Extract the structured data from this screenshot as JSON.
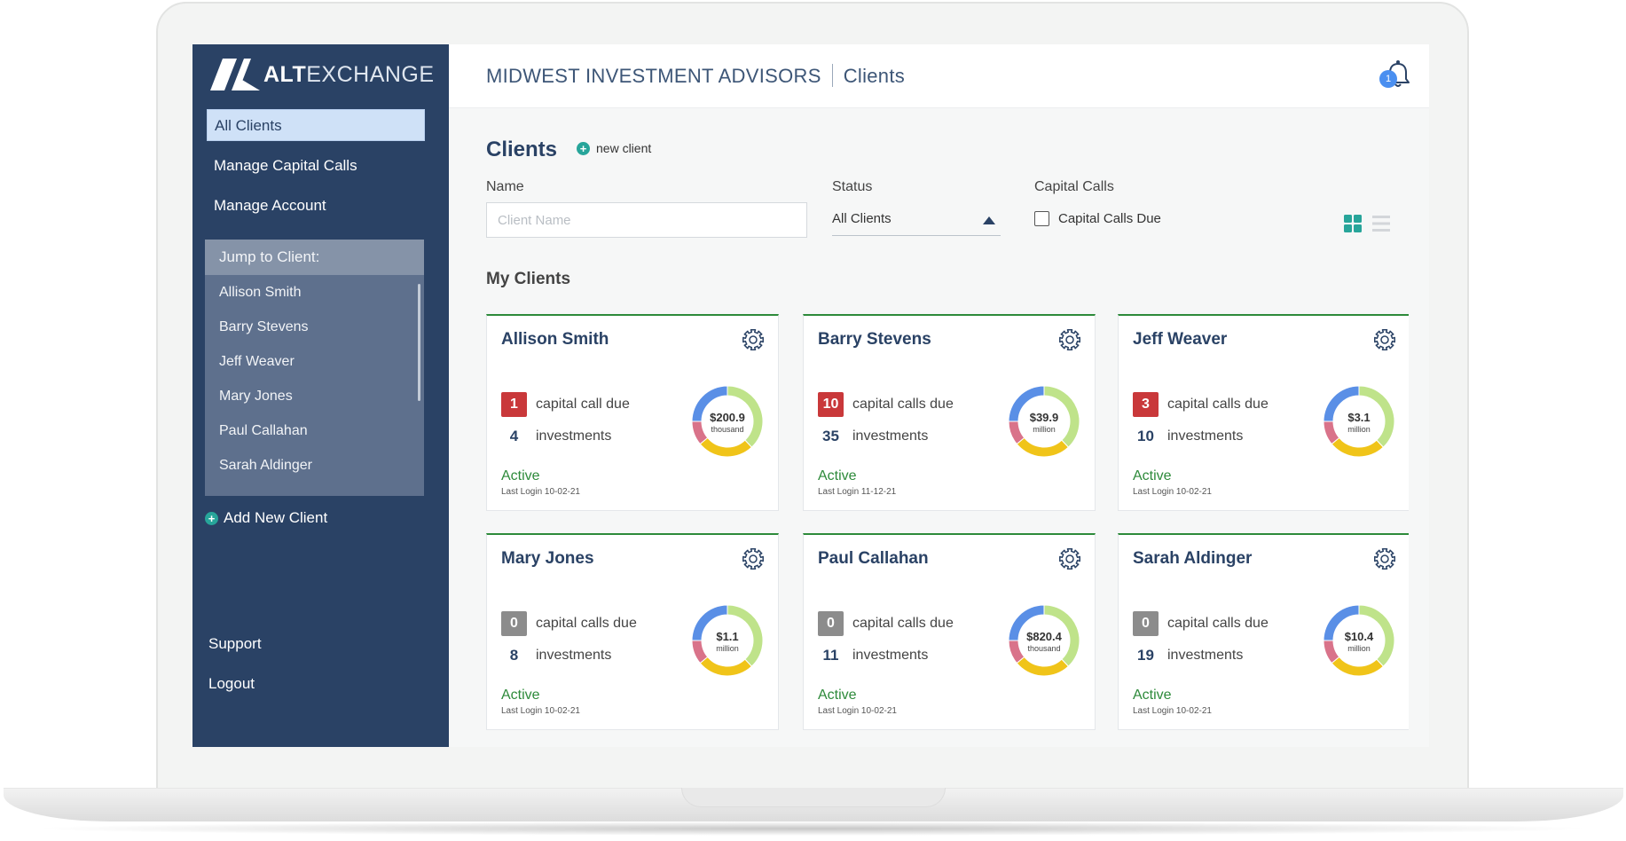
{
  "app": {
    "logo_bold": "ALT",
    "logo_light": "EXCHANGE"
  },
  "header": {
    "org_name": "MIDWEST INVESTMENT ADVISORS",
    "section": "Clients",
    "notification_count": "1"
  },
  "sidebar": {
    "nav": [
      {
        "label": "All Clients",
        "active": true
      },
      {
        "label": "Manage Capital Calls",
        "active": false
      },
      {
        "label": "Manage Account",
        "active": false
      }
    ],
    "jump_title": "Jump to Client:",
    "jump_clients": [
      "Allison Smith",
      "Barry Stevens",
      "Jeff Weaver",
      "Mary Jones",
      "Paul Callahan",
      "Sarah Aldinger"
    ],
    "add_client": "Add New Client",
    "support": "Support",
    "logout": "Logout"
  },
  "main": {
    "title": "Clients",
    "new_client": "new client",
    "filters": {
      "name_label": "Name",
      "name_placeholder": "Client Name",
      "status_label": "Status",
      "status_value": "All Clients",
      "capital_calls_label": "Capital Calls",
      "capital_calls_option": "Capital Calls Due"
    },
    "section_title": "My Clients",
    "clients": [
      {
        "name": "Allison Smith",
        "calls": "1",
        "calls_label": "capital call due",
        "investments": "4",
        "investments_label": "investments",
        "amount": "$200.9",
        "unit": "thousand",
        "status": "Active",
        "last_login": "Last Login 10-02-21",
        "has_due": true
      },
      {
        "name": "Barry Stevens",
        "calls": "10",
        "calls_label": "capital calls due",
        "investments": "35",
        "investments_label": "investments",
        "amount": "$39.9",
        "unit": "million",
        "status": "Active",
        "last_login": "Last Login 11-12-21",
        "has_due": true
      },
      {
        "name": "Jeff Weaver",
        "calls": "3",
        "calls_label": "capital calls due",
        "investments": "10",
        "investments_label": "investments",
        "amount": "$3.1",
        "unit": "million",
        "status": "Active",
        "last_login": "Last Login 10-02-21",
        "has_due": true
      },
      {
        "name": "Mary Jones",
        "calls": "0",
        "calls_label": "capital calls due",
        "investments": "8",
        "investments_label": "investments",
        "amount": "$1.1",
        "unit": "million",
        "status": "Active",
        "last_login": "Last Login 10-02-21",
        "has_due": false
      },
      {
        "name": "Paul Callahan",
        "calls": "0",
        "calls_label": "capital calls due",
        "investments": "11",
        "investments_label": "investments",
        "amount": "$820.4",
        "unit": "thousand",
        "status": "Active",
        "last_login": "Last Login 10-02-21",
        "has_due": false
      },
      {
        "name": "Sarah Aldinger",
        "calls": "0",
        "calls_label": "capital calls due",
        "investments": "19",
        "investments_label": "investments",
        "amount": "$10.4",
        "unit": "million",
        "status": "Active",
        "last_login": "Last Login 10-02-21",
        "has_due": false
      }
    ],
    "donut_colors": [
      "#bfe38a",
      "#f0c419",
      "#d9738a",
      "#5a8fe6"
    ],
    "donut_shares": [
      0.38,
      0.26,
      0.11,
      0.25
    ]
  },
  "colors": {
    "sidebar": "#2a4265",
    "accent_teal": "#27a59a",
    "active_green": "#2d8a3a",
    "due_red": "#c9383a"
  }
}
